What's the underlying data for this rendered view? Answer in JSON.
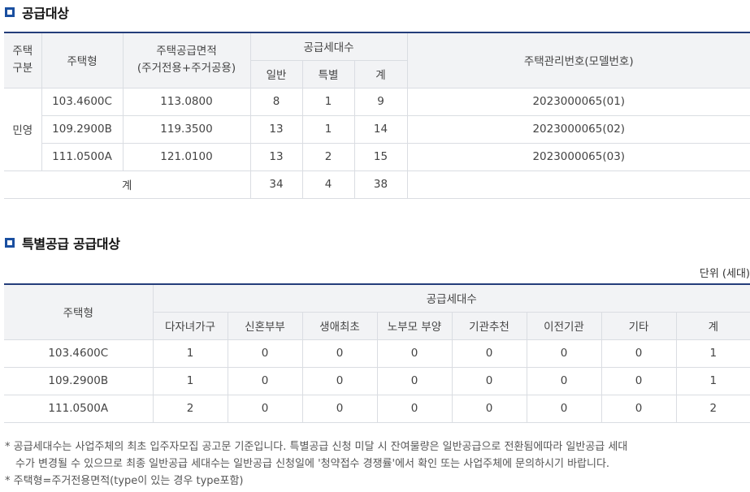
{
  "section1": {
    "title": "공급대상",
    "headers": {
      "type_group": "주택\n구분",
      "house_type": "주택형",
      "area": "주택공급면적\n(주거전용+주거공용)",
      "supply": "공급세대수",
      "general": "일반",
      "special": "특별",
      "total": "계",
      "mgmt_no": "주택관리번호(모델번호)"
    },
    "group_label": "민영",
    "rows": [
      {
        "type": "103.4600C",
        "area": "113.0800",
        "general": "8",
        "special": "1",
        "total": "9",
        "mgmt": "2023000065(01)"
      },
      {
        "type": "109.2900B",
        "area": "119.3500",
        "general": "13",
        "special": "1",
        "total": "14",
        "mgmt": "2023000065(02)"
      },
      {
        "type": "111.0500A",
        "area": "121.0100",
        "general": "13",
        "special": "2",
        "total": "15",
        "mgmt": "2023000065(03)"
      }
    ],
    "sum": {
      "label": "계",
      "general": "34",
      "special": "4",
      "total": "38",
      "mgmt": ""
    }
  },
  "section2": {
    "title": "특별공급 공급대상",
    "unit": "단위 (세대)",
    "headers": {
      "house_type": "주택형",
      "supply": "공급세대수",
      "cols": [
        "다자녀가구",
        "신혼부부",
        "생애최초",
        "노부모 부양",
        "기관추천",
        "이전기관",
        "기타",
        "계"
      ]
    },
    "rows": [
      {
        "type": "103.4600C",
        "values": [
          "1",
          "0",
          "0",
          "0",
          "0",
          "0",
          "0",
          "1"
        ]
      },
      {
        "type": "109.2900B",
        "values": [
          "1",
          "0",
          "0",
          "0",
          "0",
          "0",
          "0",
          "1"
        ]
      },
      {
        "type": "111.0500A",
        "values": [
          "2",
          "0",
          "0",
          "0",
          "0",
          "0",
          "0",
          "2"
        ]
      }
    ]
  },
  "notes": {
    "line1": "* 공급세대수는 사업주체의 최초 입주자모집 공고문 기준입니다. 특별공급 신청 미달 시 잔여물량은 일반공급으로 전환됨에따라 일반공급 세대",
    "line2": "수가 변경될 수 있으므로 최종 일반공급 세대수는 일반공급 신청일에 '청약접수 경쟁률'에서 확인 또는 사업주체에 문의하시기 바랍니다.",
    "line3": "* 주택형=주거전용면적(type이 있는 경우 type포함)"
  },
  "colors": {
    "accent": "#1a4fa0",
    "table_top_border": "#243d7a",
    "header_bg": "#f2f3f5"
  }
}
